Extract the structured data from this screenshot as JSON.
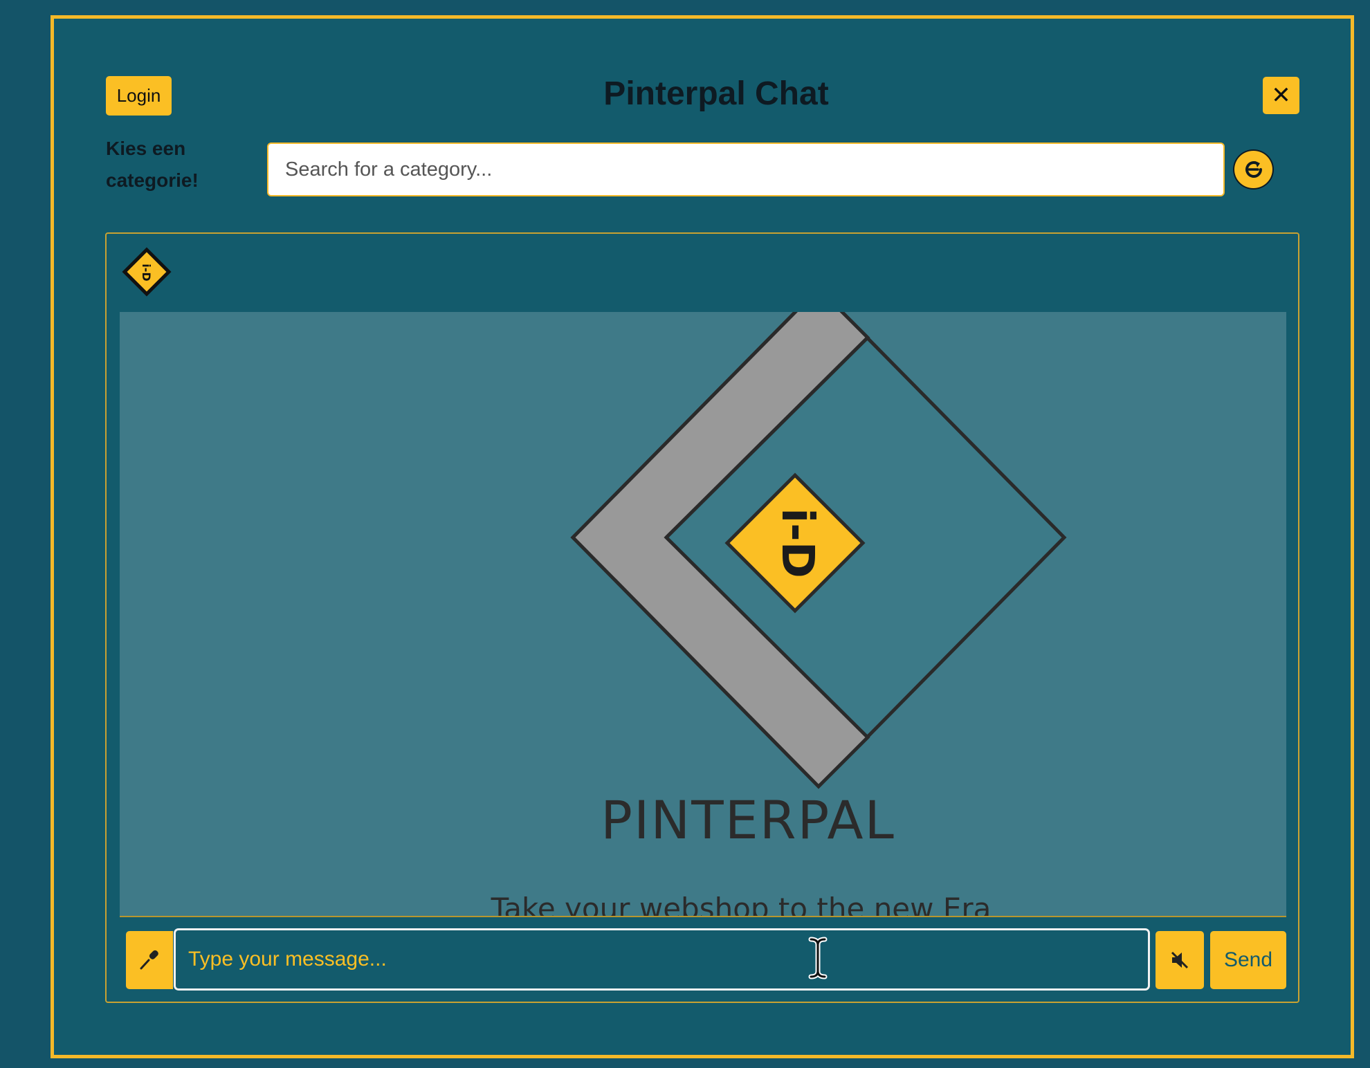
{
  "header": {
    "login_label": "Login",
    "title": "Pinterpal Chat",
    "close_label": "✕"
  },
  "category": {
    "label": "Kies een categorie!",
    "search_placeholder": "Search for a category..."
  },
  "preview": {
    "logo_mark": "i-D",
    "brand_name": "PINTERPAL",
    "tagline": "Take your webshop to the new Era"
  },
  "composer": {
    "message_placeholder": "Type your message...",
    "send_label": "Send"
  },
  "colors": {
    "background": "#145468",
    "accent": "#fbbf24",
    "panel": "#135b6c"
  }
}
